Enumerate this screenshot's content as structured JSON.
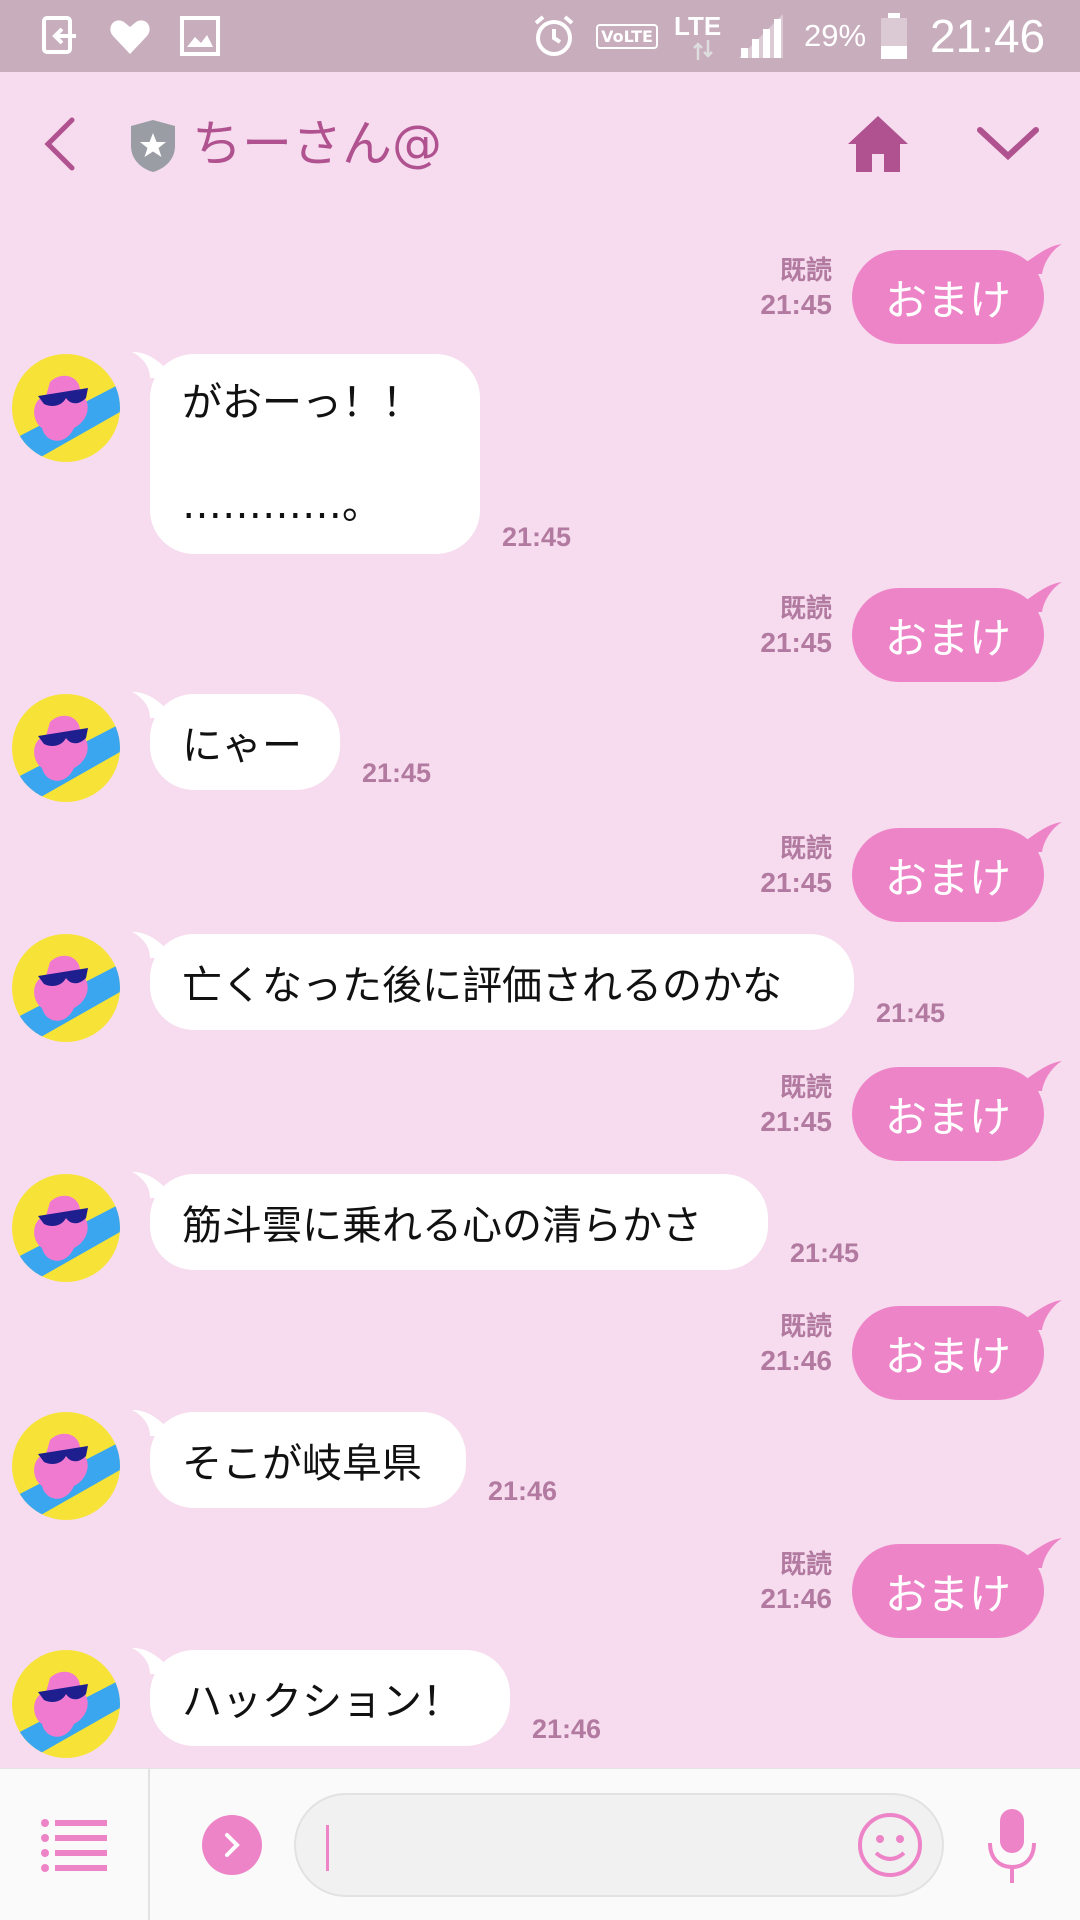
{
  "status_bar": {
    "network": "LTE",
    "volte": "VoLTE",
    "battery": "29%",
    "time": "21:46",
    "icons": [
      "download-icon",
      "heart-icon",
      "image-icon",
      "alarm-icon",
      "volte-icon",
      "lte-arrows-icon",
      "signal-icon",
      "battery-icon"
    ]
  },
  "header": {
    "title": "ちーさん@",
    "icons": [
      "back-chevron-icon",
      "shield-star-icon",
      "home-icon",
      "chevron-down-icon"
    ],
    "accent_color": "#b0528f"
  },
  "theme": {
    "background": "#f6dcee",
    "outgoing_bubble": "#ee84c8",
    "incoming_bubble": "#ffffff",
    "meta_text": "#b27aa0"
  },
  "messages": [
    {
      "direction": "out",
      "text": "おまけ",
      "read": "既読",
      "time": "21:45"
    },
    {
      "direction": "in",
      "lines": [
        "がおーっ！！",
        "",
        "…………。"
      ],
      "time": "21:45"
    },
    {
      "direction": "out",
      "text": "おまけ",
      "read": "既読",
      "time": "21:45"
    },
    {
      "direction": "in",
      "text": "にゃー",
      "time": "21:45"
    },
    {
      "direction": "out",
      "text": "おまけ",
      "read": "既読",
      "time": "21:45"
    },
    {
      "direction": "in",
      "text": "亡くなった後に評価されるのかな",
      "time": "21:45"
    },
    {
      "direction": "out",
      "text": "おまけ",
      "read": "既読",
      "time": "21:45"
    },
    {
      "direction": "in",
      "text": "筋斗雲に乗れる心の清らかさ",
      "time": "21:45"
    },
    {
      "direction": "out",
      "text": "おまけ",
      "read": "既読",
      "time": "21:46"
    },
    {
      "direction": "in",
      "text": "そこが岐阜県",
      "time": "21:46"
    },
    {
      "direction": "out",
      "text": "おまけ",
      "read": "既読",
      "time": "21:46"
    },
    {
      "direction": "in",
      "text": "ハックション！",
      "time": "21:46"
    }
  ],
  "input_bar": {
    "message_value": "",
    "icons": [
      "menu-list-icon",
      "expand-arrow-icon",
      "emoji-icon",
      "microphone-icon"
    ]
  }
}
